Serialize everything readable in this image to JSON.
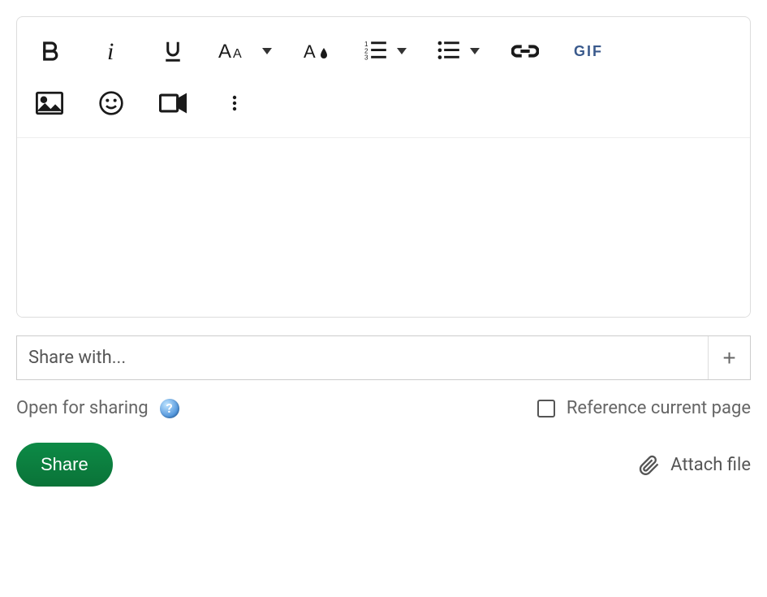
{
  "toolbar": {
    "bold_title": "Bold",
    "italic_title": "Italic",
    "underline_title": "Underline",
    "font_size_title": "Font size",
    "text_color_title": "Text color",
    "ordered_list_title": "Ordered list",
    "unordered_list_title": "Unordered list",
    "link_title": "Insert link",
    "gif_label": "GIF",
    "image_title": "Insert image",
    "emoji_title": "Insert emoji",
    "video_title": "Insert video",
    "more_title": "More options"
  },
  "share_input": {
    "placeholder": "Share with...",
    "value": ""
  },
  "add_button_label": "+",
  "open_for_sharing_label": "Open for sharing",
  "help_symbol": "?",
  "reference_current_page_label": "Reference current page",
  "reference_current_page_checked": false,
  "share_button_label": "Share",
  "attach_file_label": "Attach file",
  "colors": {
    "share_button_bg": "#0a7a3e"
  }
}
